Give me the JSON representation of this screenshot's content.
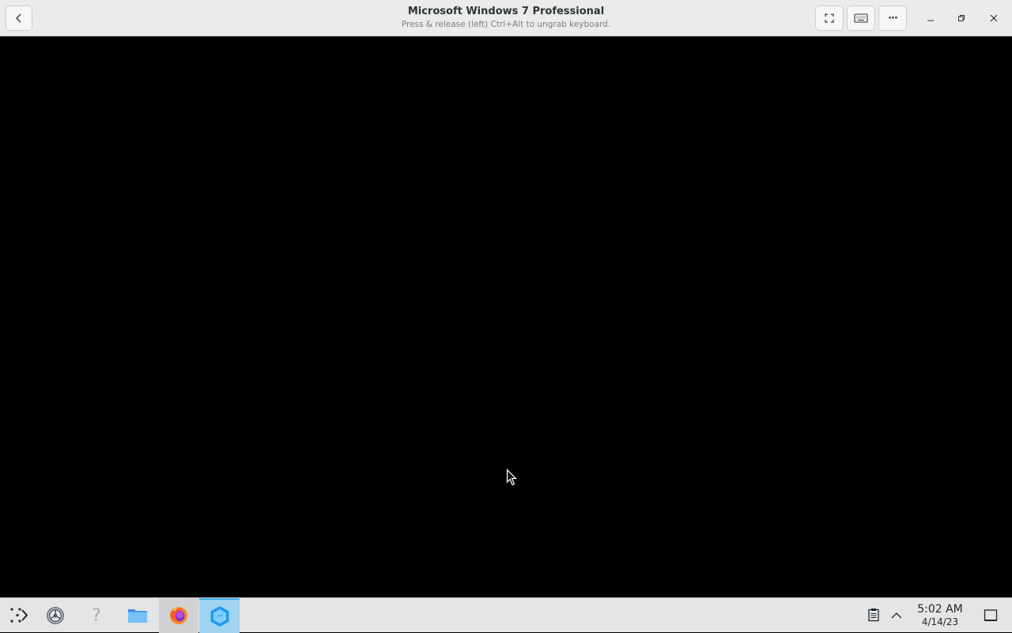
{
  "window": {
    "title": "Microsoft Windows 7 Professional",
    "subtitle": "Press & release (left) Ctrl+Alt to ungrab keyboard.",
    "buttons": {
      "back_icon": "chevron-left-icon",
      "fullscreen_icon": "fullscreen-icon",
      "keyboard_icon": "keyboard-icon",
      "menu_icon": "more-horizontal-icon",
      "menu_label": "···",
      "minimize_icon": "minimize-icon",
      "maximize_icon": "restore-icon",
      "close_icon": "close-icon"
    }
  },
  "vm_screen": {
    "background": "#000000",
    "cursor_icon": "pointer-cursor-icon"
  },
  "taskbar": {
    "items": [
      {
        "name": "application-launcher",
        "icon": "launcher-icon"
      },
      {
        "name": "system-settings",
        "icon": "settings-icon"
      },
      {
        "name": "help",
        "icon": "help-icon",
        "label": "?"
      },
      {
        "name": "file-manager",
        "icon": "folder-icon"
      },
      {
        "name": "firefox",
        "icon": "firefox-icon"
      },
      {
        "name": "virtual-machine-manager",
        "icon": "vm-icon",
        "active": true
      }
    ],
    "tray": {
      "clipboard_icon": "clipboard-icon",
      "expand_icon": "chevron-up-icon",
      "time": "5:02 AM",
      "date": "4/14/23",
      "show_desktop_icon": "show-desktop-icon"
    },
    "accent_color": "#3daee9"
  }
}
